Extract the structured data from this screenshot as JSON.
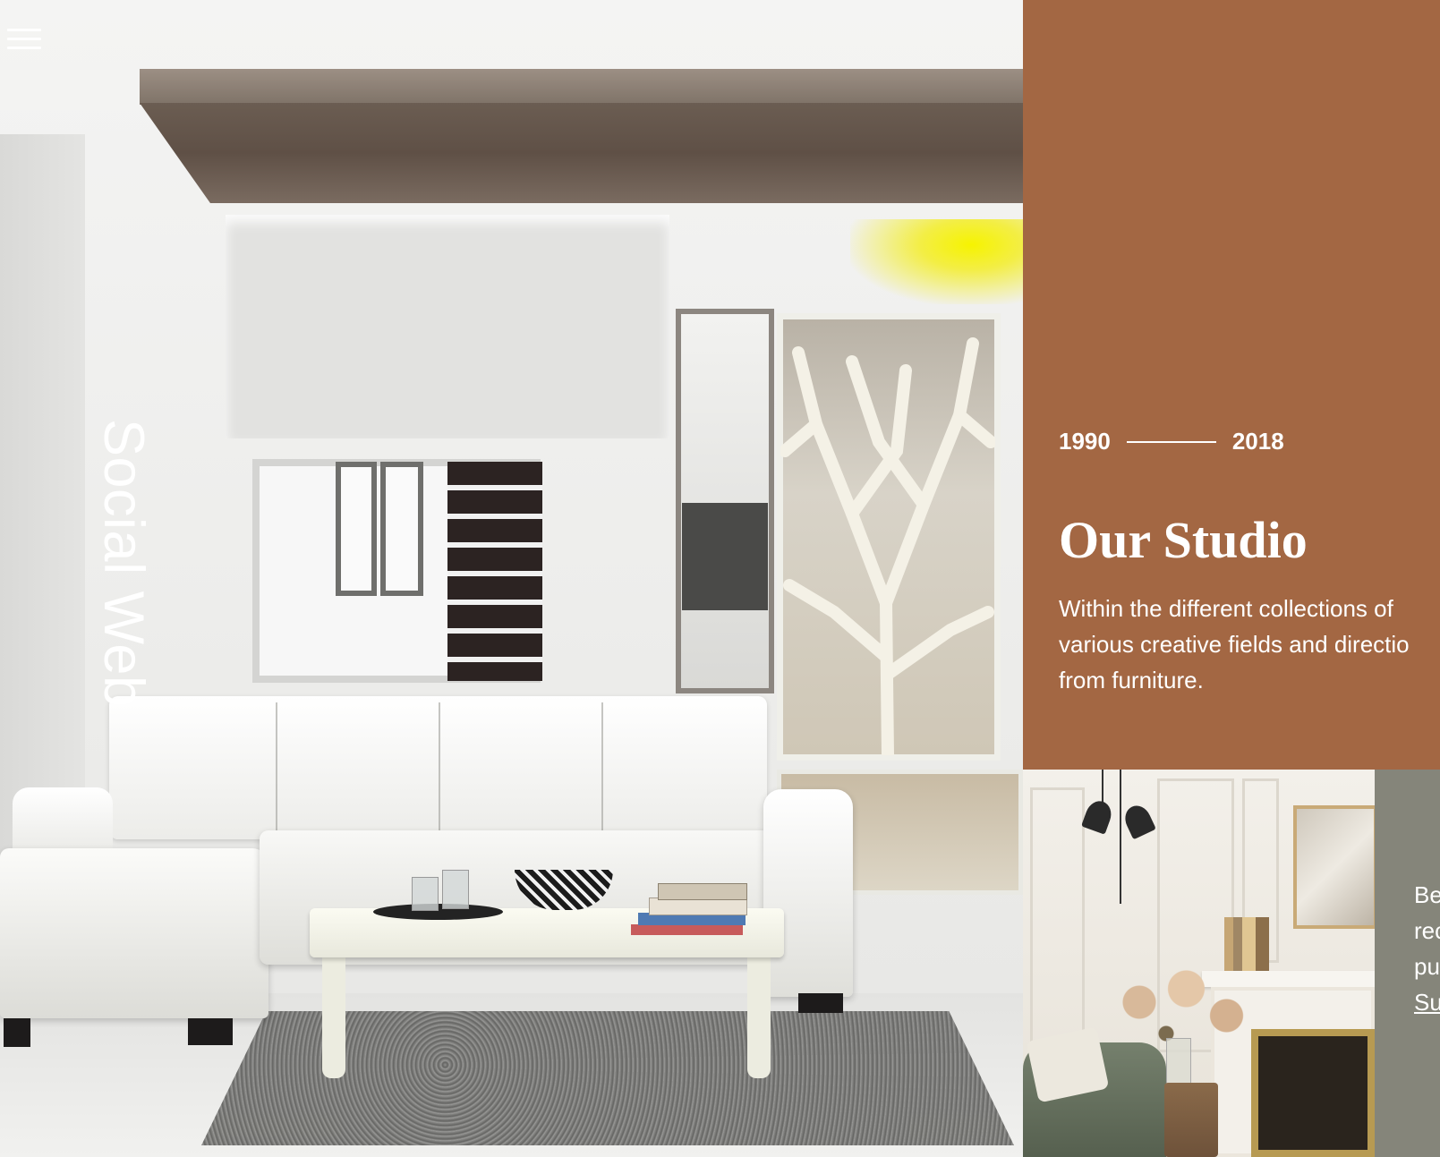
{
  "hero": {
    "vertical_title": "Social Web",
    "menu_icon": "hamburger-menu-icon"
  },
  "studio": {
    "year_start": "1990",
    "year_end": "2018",
    "title": "Our Studio",
    "description_lines": [
      "Within the different collections of",
      "various creative fields and directio",
      "from furniture."
    ]
  },
  "promo": {
    "lines": [
      "Be",
      "rec",
      "pul"
    ],
    "link_label": "Su"
  },
  "colors": {
    "studio_panel": "#a36743",
    "promo_panel": "#85857a",
    "text": "#ffffff"
  }
}
